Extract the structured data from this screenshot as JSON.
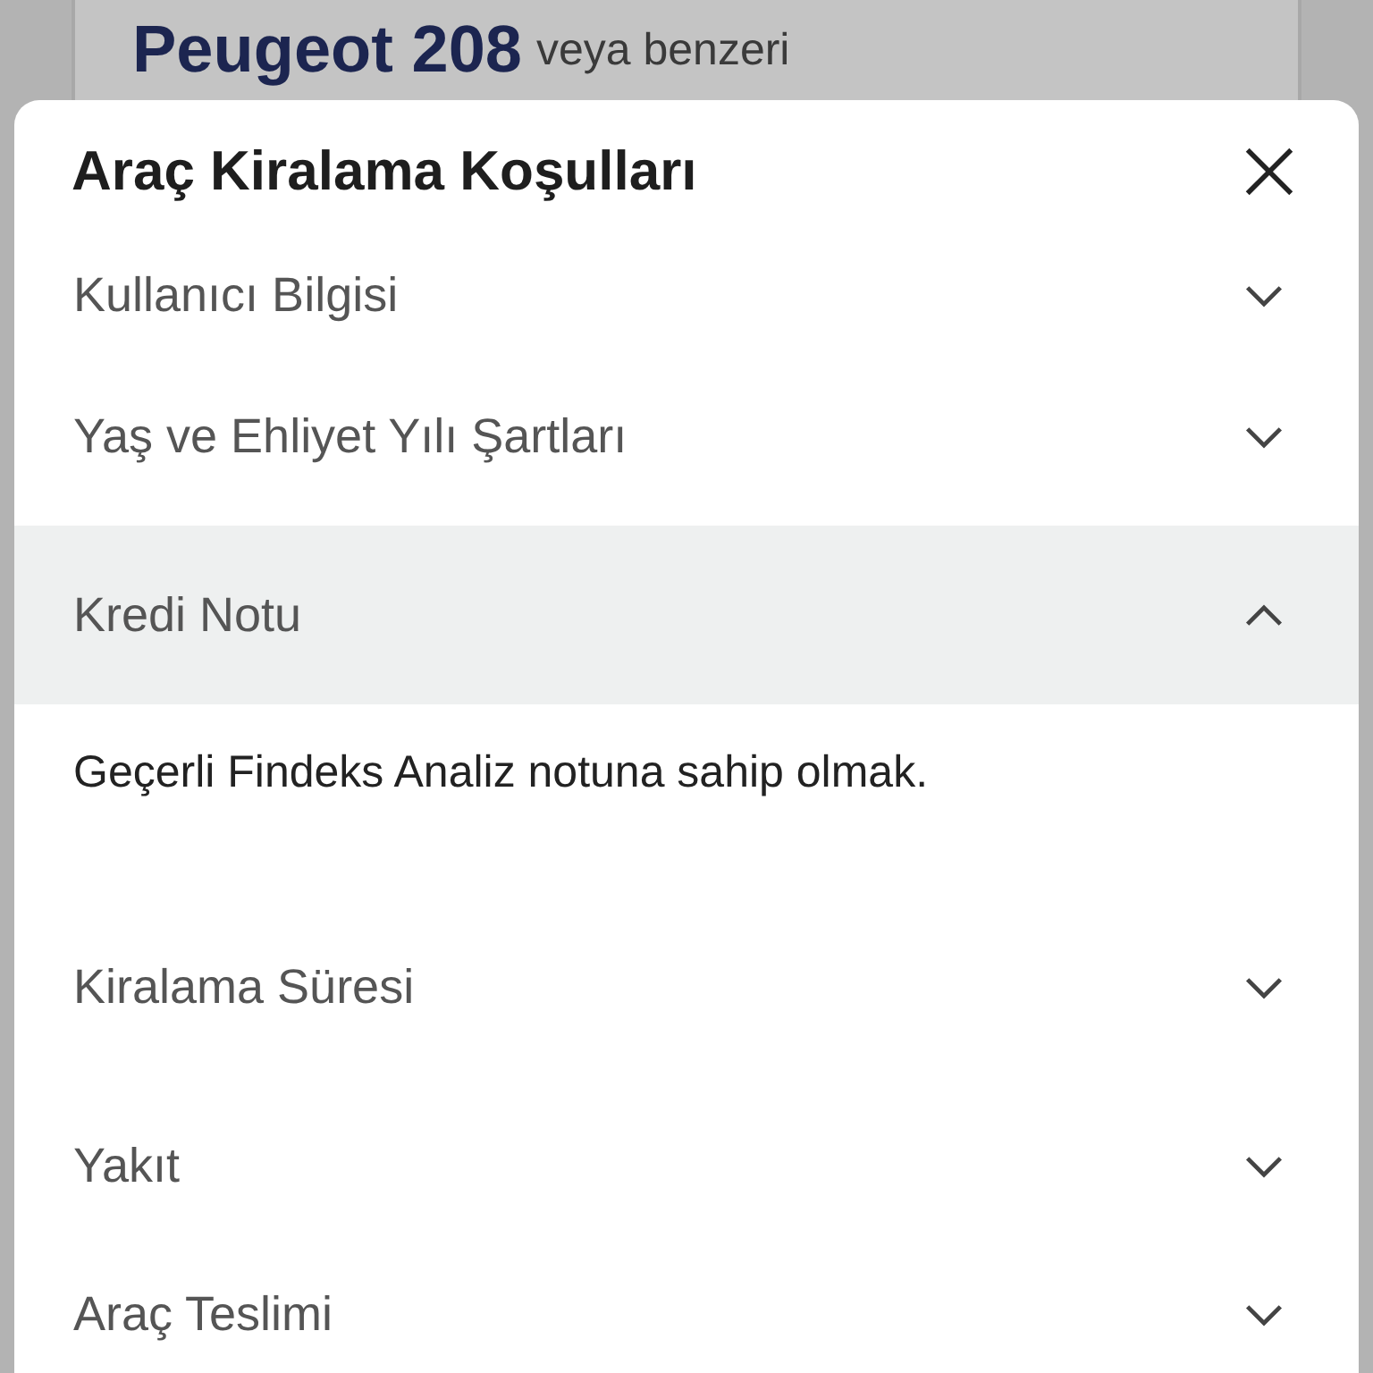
{
  "background_card": {
    "model": "Peugeot 208",
    "suffix": "veya benzeri"
  },
  "modal": {
    "title": "Araç Kiralama Koşulları",
    "sections": [
      {
        "title": "Kullanıcı Bilgisi",
        "expanded": false
      },
      {
        "title": "Yaş ve Ehliyet Yılı Şartları",
        "expanded": false
      },
      {
        "title": "Kredi Notu",
        "expanded": true,
        "content": "Geçerli Findeks Analiz notuna sahip olmak."
      },
      {
        "title": "Kiralama Süresi",
        "expanded": false
      },
      {
        "title": "Yakıt",
        "expanded": false
      },
      {
        "title": "Araç Teslimi",
        "expanded": false
      }
    ]
  }
}
